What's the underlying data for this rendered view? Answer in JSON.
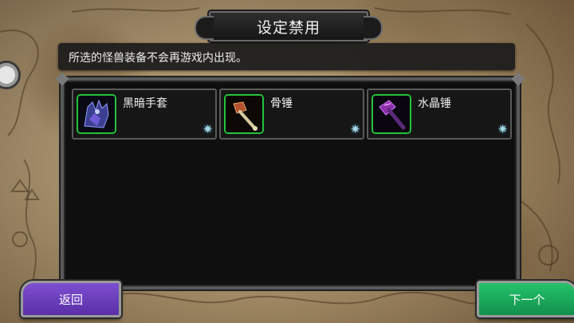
{
  "screen": {
    "title": "设定禁用",
    "instruction": "所选的怪兽装备不会再游戏内出现。"
  },
  "items": [
    {
      "name": "黑暗手套",
      "icon": "dark-gauntlet-icon",
      "rarity_icon": "ice-star-icon",
      "star": "✷",
      "frame_color": "#23c23a"
    },
    {
      "name": "骨锤",
      "icon": "bone-hammer-icon",
      "rarity_icon": "ice-star-icon",
      "star": "✷",
      "frame_color": "#23c23a"
    },
    {
      "name": "水晶锤",
      "icon": "crystal-hammer-icon",
      "rarity_icon": "ice-star-icon",
      "star": "✷",
      "frame_color": "#23c23a"
    }
  ],
  "buttons": {
    "back": "返回",
    "next": "下一个"
  },
  "colors": {
    "back_button": "#6a3cc0",
    "next_button": "#1aa85a",
    "item_frame": "#23c23a"
  }
}
